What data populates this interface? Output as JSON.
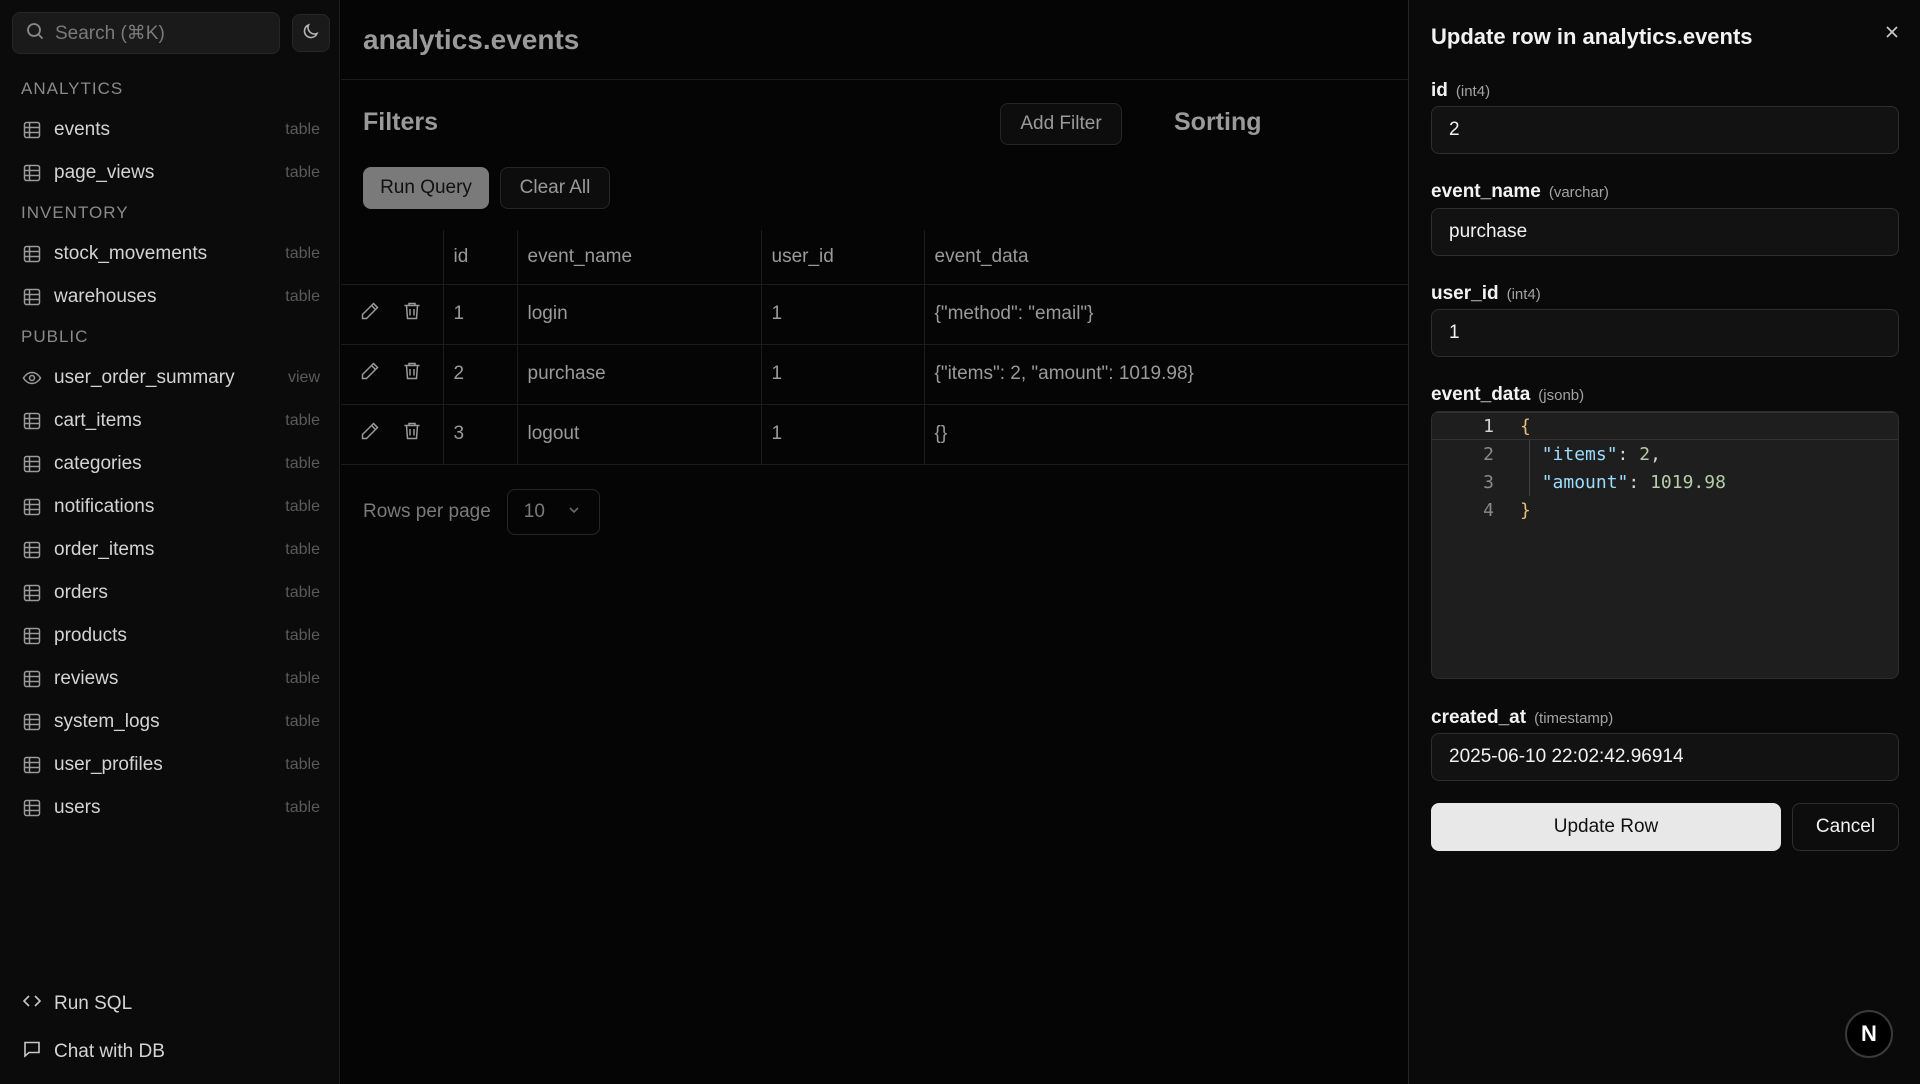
{
  "sidebar": {
    "search_placeholder": "Search (⌘K)",
    "sections": [
      {
        "label": "ANALYTICS",
        "items": [
          {
            "name": "events",
            "kind": "table"
          },
          {
            "name": "page_views",
            "kind": "table"
          }
        ]
      },
      {
        "label": "INVENTORY",
        "items": [
          {
            "name": "stock_movements",
            "kind": "table"
          },
          {
            "name": "warehouses",
            "kind": "table"
          }
        ]
      },
      {
        "label": "PUBLIC",
        "items": [
          {
            "name": "user_order_summary",
            "kind": "view"
          },
          {
            "name": "cart_items",
            "kind": "table"
          },
          {
            "name": "categories",
            "kind": "table"
          },
          {
            "name": "notifications",
            "kind": "table"
          },
          {
            "name": "order_items",
            "kind": "table"
          },
          {
            "name": "orders",
            "kind": "table"
          },
          {
            "name": "products",
            "kind": "table"
          },
          {
            "name": "reviews",
            "kind": "table"
          },
          {
            "name": "system_logs",
            "kind": "table"
          },
          {
            "name": "user_profiles",
            "kind": "table"
          },
          {
            "name": "users",
            "kind": "table"
          }
        ]
      }
    ],
    "bottom": {
      "run_sql": "Run SQL",
      "chat": "Chat with DB"
    }
  },
  "main": {
    "title": "analytics.events",
    "filters_title": "Filters",
    "add_filter": "Add Filter",
    "sorting_title": "Sorting",
    "run_query": "Run Query",
    "clear_all": "Clear All",
    "columns": [
      "id",
      "event_name",
      "user_id",
      "event_data"
    ],
    "rows": [
      {
        "id": "1",
        "event_name": "login",
        "user_id": "1",
        "event_data": "{\"method\": \"email\"}"
      },
      {
        "id": "2",
        "event_name": "purchase",
        "user_id": "1",
        "event_data": "{\"items\": 2, \"amount\": 1019.98}"
      },
      {
        "id": "3",
        "event_name": "logout",
        "user_id": "1",
        "event_data": "{}"
      }
    ],
    "rows_per_page_label": "Rows per page",
    "rows_per_page_value": "10"
  },
  "drawer": {
    "title": "Update row in analytics.events",
    "fields": {
      "id": {
        "label": "id",
        "type": "(int4)",
        "value": "2"
      },
      "event_name": {
        "label": "event_name",
        "type": "(varchar)",
        "value": "purchase"
      },
      "user_id": {
        "label": "user_id",
        "type": "(int4)",
        "value": "1"
      },
      "event_data": {
        "label": "event_data",
        "type": "(jsonb)"
      },
      "created_at": {
        "label": "created_at",
        "type": "(timestamp)",
        "value": "2025-06-10 22:02:42.96914"
      }
    },
    "editor": {
      "line_numbers": [
        "1",
        "2",
        "3",
        "4"
      ],
      "open_brace": "{",
      "key_items": "\"items\"",
      "colon1": ": ",
      "val_items": "2",
      "comma": ",",
      "key_amount": "\"amount\"",
      "colon2": ": ",
      "val_amount": "1019.98",
      "close_brace": "}"
    },
    "update_button": "Update Row",
    "cancel_button": "Cancel"
  },
  "badge": "N"
}
